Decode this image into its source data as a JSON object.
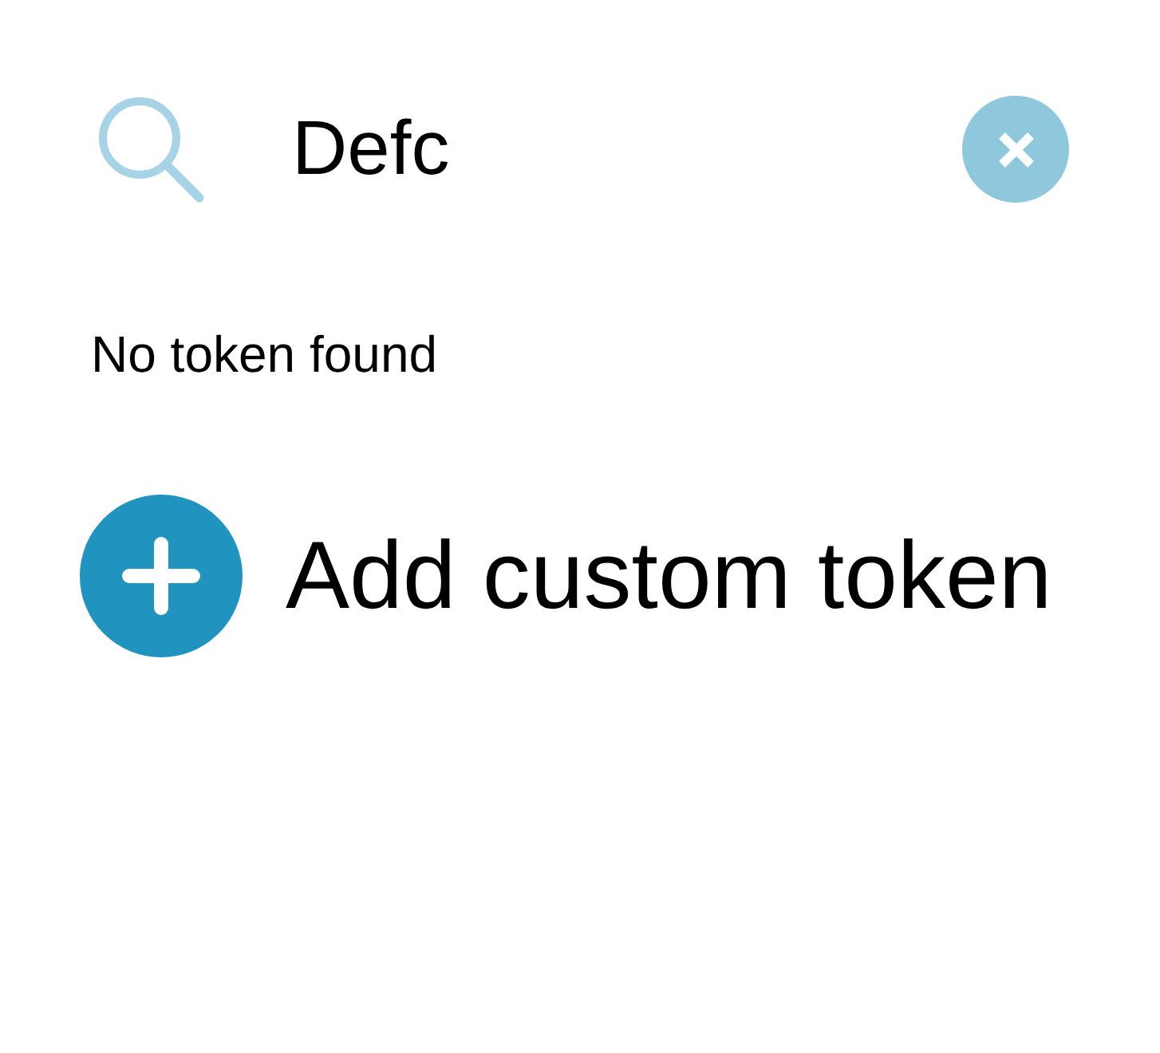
{
  "search": {
    "value": "Defc"
  },
  "message": "No token found",
  "add_button": {
    "label": "Add custom token"
  }
}
